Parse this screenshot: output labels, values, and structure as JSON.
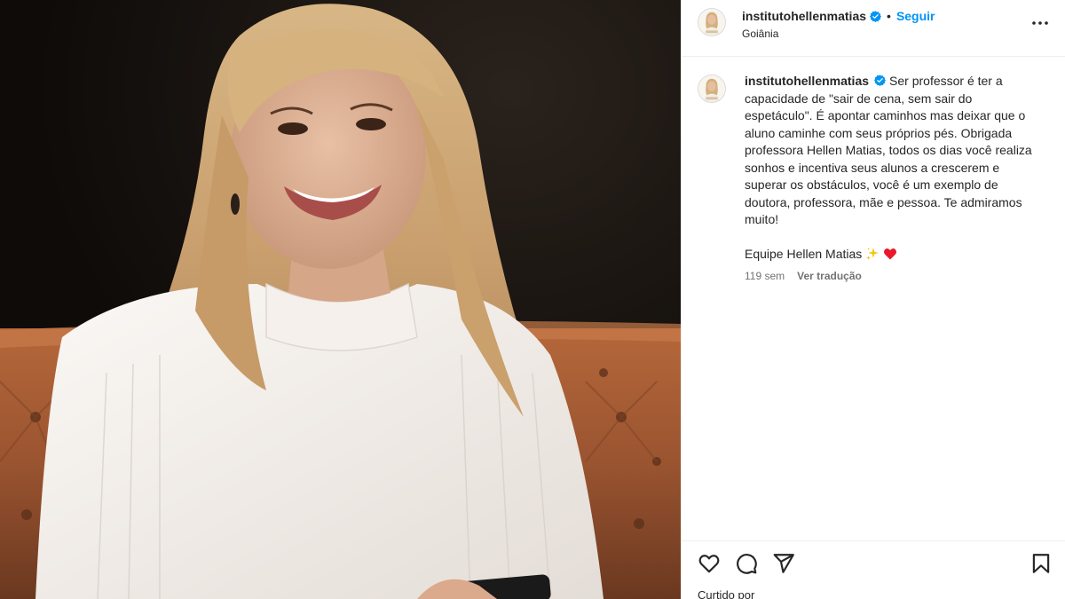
{
  "post": {
    "username": "institutohellenmatias",
    "follow_label": "Seguir",
    "separator": "•",
    "location": "Goiânia",
    "more_icon": "more-horizontal-icon"
  },
  "caption": {
    "username": "institutohellenmatias",
    "text": "Ser professor é ter a capacidade de \"sair de cena, sem sair do espetáculo\". É apontar caminhos mas deixar que o aluno caminhe com seus próprios pés. Obrigada professora Hellen Matias, todos os dias você realiza sonhos e incentiva seus alunos a crescerem e superar os obstáculos, você é um exemplo de doutora, professora, mãe e pessoa. Te admiramos muito!",
    "signature": "Equipe Hellen Matias",
    "signature_emojis": [
      "sparkles-icon",
      "red-heart-icon"
    ],
    "time_ago": "119 sem",
    "translate_label": "Ver tradução"
  },
  "actions": {
    "icons": [
      "heart-icon",
      "comment-icon",
      "share-icon",
      "bookmark-icon"
    ],
    "liked_by_label": "Curtido por"
  },
  "colors": {
    "accent": "#0095f6",
    "verified": "#0095f6",
    "heart": "#ed4956",
    "text": "#262626",
    "secondary": "#737373"
  }
}
